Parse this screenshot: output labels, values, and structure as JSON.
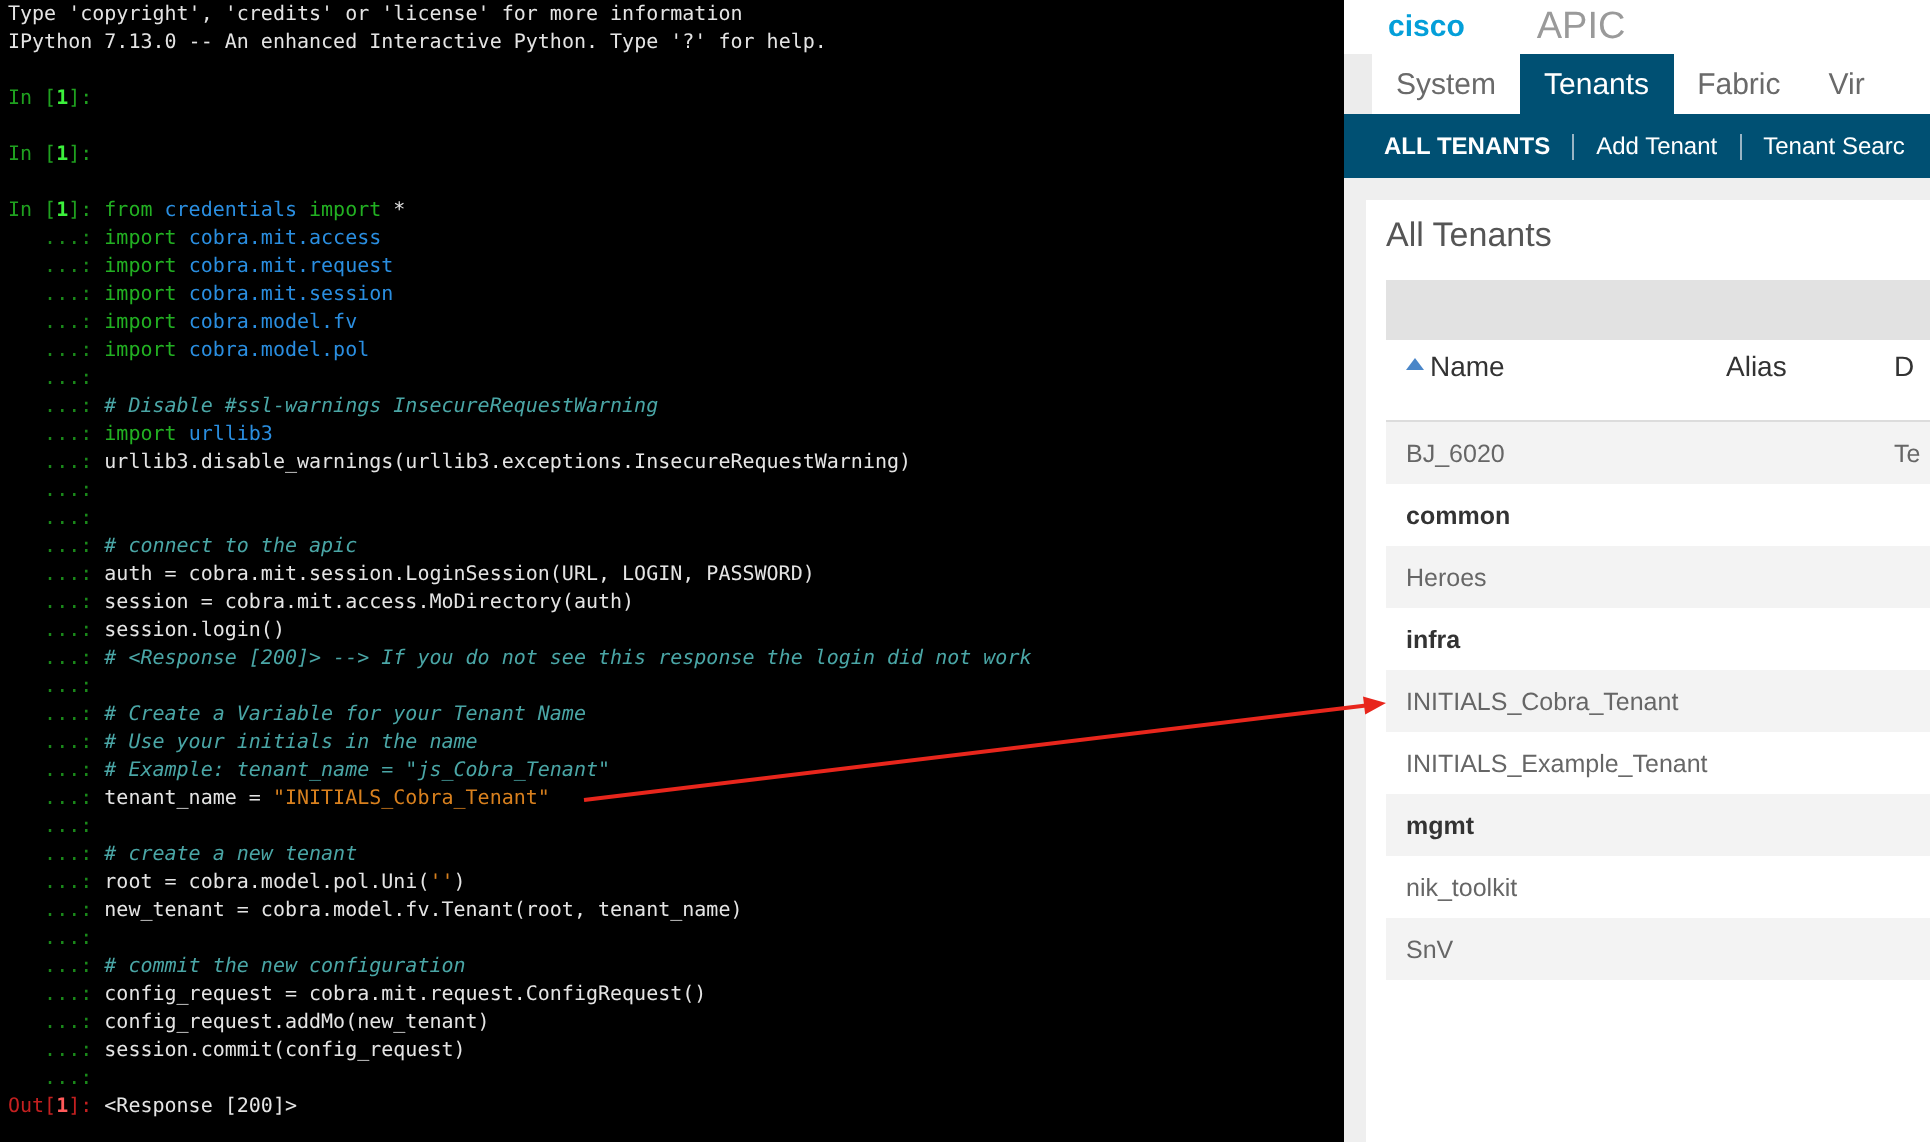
{
  "terminal": {
    "blocks": [
      {
        "lines": [
          {
            "tokens": [
              {
                "kind": "txt",
                "text": "Type 'copyright', 'credits' or 'license' for more information"
              }
            ]
          },
          {
            "tokens": [
              {
                "kind": "txt",
                "text": "IPython 7.13.0 -- An enhanced Interactive Python. Type '?' for help."
              }
            ]
          }
        ]
      },
      {
        "lines": [
          {
            "prompt": {
              "kind": "in",
              "parts": [
                "In [",
                "1",
                "]:"
              ]
            }
          }
        ]
      },
      {
        "lines": [
          {
            "prompt": {
              "kind": "in",
              "parts": [
                "In [",
                "1",
                "]:"
              ]
            }
          }
        ]
      },
      {
        "lines": [
          {
            "prompt": {
              "kind": "in",
              "parts": [
                "In [",
                "1",
                "]:"
              ]
            },
            "tokens": [
              {
                "kind": "kw",
                "text": "from "
              },
              {
                "kind": "mod",
                "text": "credentials "
              },
              {
                "kind": "kw",
                "text": "import"
              },
              {
                "kind": "txt",
                "text": " *"
              }
            ]
          },
          {
            "prompt": {
              "kind": "cont",
              "parts": [
                "...:"
              ]
            },
            "tokens": [
              {
                "kind": "kw",
                "text": "import "
              },
              {
                "kind": "mod",
                "text": "cobra.mit.access"
              }
            ]
          },
          {
            "prompt": {
              "kind": "cont",
              "parts": [
                "...:"
              ]
            },
            "tokens": [
              {
                "kind": "kw",
                "text": "import "
              },
              {
                "kind": "mod",
                "text": "cobra.mit.request"
              }
            ]
          },
          {
            "prompt": {
              "kind": "cont",
              "parts": [
                "...:"
              ]
            },
            "tokens": [
              {
                "kind": "kw",
                "text": "import "
              },
              {
                "kind": "mod",
                "text": "cobra.mit.session"
              }
            ]
          },
          {
            "prompt": {
              "kind": "cont",
              "parts": [
                "...:"
              ]
            },
            "tokens": [
              {
                "kind": "kw",
                "text": "import "
              },
              {
                "kind": "mod",
                "text": "cobra.model.fv"
              }
            ]
          },
          {
            "prompt": {
              "kind": "cont",
              "parts": [
                "...:"
              ]
            },
            "tokens": [
              {
                "kind": "kw",
                "text": "import "
              },
              {
                "kind": "mod",
                "text": "cobra.model.pol"
              }
            ]
          },
          {
            "prompt": {
              "kind": "cont",
              "parts": [
                "...:"
              ]
            }
          },
          {
            "prompt": {
              "kind": "cont",
              "parts": [
                "...:"
              ]
            },
            "tokens": [
              {
                "kind": "com",
                "text": "# Disable #ssl-warnings InsecureRequestWarning"
              }
            ]
          },
          {
            "prompt": {
              "kind": "cont",
              "parts": [
                "...:"
              ]
            },
            "tokens": [
              {
                "kind": "kw",
                "text": "import "
              },
              {
                "kind": "mod",
                "text": "urllib3"
              }
            ]
          },
          {
            "prompt": {
              "kind": "cont",
              "parts": [
                "...:"
              ]
            },
            "tokens": [
              {
                "kind": "txt",
                "text": "urllib3.disable_warnings(urllib3.exceptions.InsecureRequestWarning)"
              }
            ]
          },
          {
            "prompt": {
              "kind": "cont",
              "parts": [
                "...:"
              ]
            }
          },
          {
            "prompt": {
              "kind": "cont",
              "parts": [
                "...:"
              ]
            }
          },
          {
            "prompt": {
              "kind": "cont",
              "parts": [
                "...:"
              ]
            },
            "tokens": [
              {
                "kind": "com",
                "text": "# connect to the apic"
              }
            ]
          },
          {
            "prompt": {
              "kind": "cont",
              "parts": [
                "...:"
              ]
            },
            "tokens": [
              {
                "kind": "txt",
                "text": "auth = cobra.mit.session.LoginSession(URL, LOGIN, PASSWORD)"
              }
            ]
          },
          {
            "prompt": {
              "kind": "cont",
              "parts": [
                "...:"
              ]
            },
            "tokens": [
              {
                "kind": "txt",
                "text": "session = cobra.mit.access.MoDirectory(auth)"
              }
            ]
          },
          {
            "prompt": {
              "kind": "cont",
              "parts": [
                "...:"
              ]
            },
            "tokens": [
              {
                "kind": "txt",
                "text": "session.login()"
              }
            ]
          },
          {
            "prompt": {
              "kind": "cont",
              "parts": [
                "...:"
              ]
            },
            "tokens": [
              {
                "kind": "com",
                "text": "# <Response [200]> --> If you do not see this response the login did not work"
              }
            ]
          },
          {
            "prompt": {
              "kind": "cont",
              "parts": [
                "...:"
              ]
            }
          },
          {
            "prompt": {
              "kind": "cont",
              "parts": [
                "...:"
              ]
            },
            "tokens": [
              {
                "kind": "com",
                "text": "# Create a Variable for your Tenant Name"
              }
            ]
          },
          {
            "prompt": {
              "kind": "cont",
              "parts": [
                "...:"
              ]
            },
            "tokens": [
              {
                "kind": "com",
                "text": "# Use your initials in the name"
              }
            ]
          },
          {
            "prompt": {
              "kind": "cont",
              "parts": [
                "...:"
              ]
            },
            "tokens": [
              {
                "kind": "com",
                "text": "# Example: tenant_name = \"js_Cobra_Tenant\""
              }
            ]
          },
          {
            "prompt": {
              "kind": "cont",
              "parts": [
                "...:"
              ]
            },
            "tokens": [
              {
                "kind": "txt",
                "text": "tenant_name = "
              },
              {
                "kind": "str",
                "text": "\"INITIALS_Cobra_Tenant\""
              }
            ]
          },
          {
            "prompt": {
              "kind": "cont",
              "parts": [
                "...:"
              ]
            }
          },
          {
            "prompt": {
              "kind": "cont",
              "parts": [
                "...:"
              ]
            },
            "tokens": [
              {
                "kind": "com",
                "text": "# create a new tenant"
              }
            ]
          },
          {
            "prompt": {
              "kind": "cont",
              "parts": [
                "...:"
              ]
            },
            "tokens": [
              {
                "kind": "txt",
                "text": "root = cobra.model.pol.Uni("
              },
              {
                "kind": "str",
                "text": "''"
              },
              {
                "kind": "txt",
                "text": ")"
              }
            ]
          },
          {
            "prompt": {
              "kind": "cont",
              "parts": [
                "...:"
              ]
            },
            "tokens": [
              {
                "kind": "txt",
                "text": "new_tenant = cobra.model.fv.Tenant(root, tenant_name)"
              }
            ]
          },
          {
            "prompt": {
              "kind": "cont",
              "parts": [
                "...:"
              ]
            }
          },
          {
            "prompt": {
              "kind": "cont",
              "parts": [
                "...:"
              ]
            },
            "tokens": [
              {
                "kind": "com",
                "text": "# commit the new configuration"
              }
            ]
          },
          {
            "prompt": {
              "kind": "cont",
              "parts": [
                "...:"
              ]
            },
            "tokens": [
              {
                "kind": "txt",
                "text": "config_request = cobra.mit.request.ConfigRequest()"
              }
            ]
          },
          {
            "prompt": {
              "kind": "cont",
              "parts": [
                "...:"
              ]
            },
            "tokens": [
              {
                "kind": "txt",
                "text": "config_request.addMo(new_tenant)"
              }
            ]
          },
          {
            "prompt": {
              "kind": "cont",
              "parts": [
                "...:"
              ]
            },
            "tokens": [
              {
                "kind": "txt",
                "text": "session.commit(config_request)"
              }
            ]
          },
          {
            "prompt": {
              "kind": "cont",
              "parts": [
                "...:"
              ]
            }
          },
          {
            "prompt": {
              "kind": "out",
              "parts": [
                "Out[",
                "1",
                "]:"
              ]
            },
            "tokens": [
              {
                "kind": "txt",
                "text": "<Response [200]>"
              }
            ]
          }
        ]
      }
    ]
  },
  "apic": {
    "logo": "cisco",
    "product": "APIC",
    "tabs": [
      {
        "label": "System",
        "selected": false
      },
      {
        "label": "Tenants",
        "selected": true
      },
      {
        "label": "Fabric",
        "selected": false
      },
      {
        "label": "Vir",
        "selected": false
      }
    ],
    "subnav": [
      {
        "label": "ALL TENANTS",
        "selected": true
      },
      {
        "label": "Add Tenant",
        "selected": false
      },
      {
        "label": "Tenant Searc",
        "selected": false
      }
    ],
    "panel_title": "All Tenants",
    "table": {
      "columns": [
        {
          "label": "Name",
          "sorted": true
        },
        {
          "label": "Alias",
          "sorted": false
        },
        {
          "label": "D",
          "sorted": false
        }
      ],
      "rows": [
        {
          "name": "BJ_6020",
          "kind": "user",
          "column_3": "Te"
        },
        {
          "name": "common",
          "kind": "system"
        },
        {
          "name": "Heroes",
          "kind": "user"
        },
        {
          "name": "infra",
          "kind": "system"
        },
        {
          "name": "INITIALS_Cobra_Tenant",
          "kind": "user"
        },
        {
          "name": "INITIALS_Example_Tenant",
          "kind": "user"
        },
        {
          "name": "mgmt",
          "kind": "system"
        },
        {
          "name": "nik_toolkit",
          "kind": "user"
        },
        {
          "name": "SnV",
          "kind": "user"
        }
      ]
    }
  }
}
